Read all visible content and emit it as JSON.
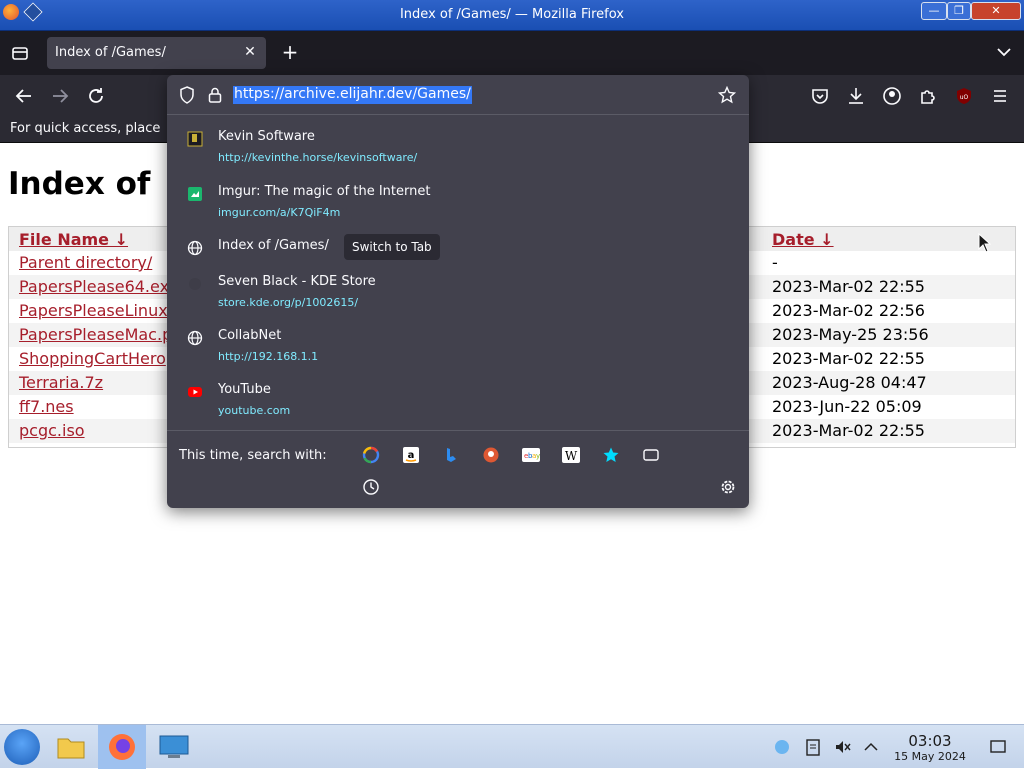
{
  "window": {
    "title": "Index of /Games/ — Mozilla Firefox"
  },
  "tab": {
    "title": "Index of /Games/"
  },
  "bookmark_bar": {
    "text": "For quick access, place"
  },
  "urlbar": {
    "url": "https://archive.elijahr.dev/Games/"
  },
  "page": {
    "heading": "Index of ",
    "columns": {
      "name": "File Name  ↓",
      "date": "Date  ↓"
    },
    "rows": [
      {
        "name": "Parent directory/",
        "date": "-"
      },
      {
        "name": "PapersPlease64.ex",
        "date": "2023-Mar-02 22:55"
      },
      {
        "name": "PapersPleaseLinux",
        "date": "2023-Mar-02 22:56"
      },
      {
        "name": "PapersPleaseMac.p",
        "date": "2023-May-25 23:56"
      },
      {
        "name": "ShoppingCartHero",
        "date": "2023-Mar-02 22:55"
      },
      {
        "name": "Terraria.7z",
        "date": "2023-Aug-28 04:47"
      },
      {
        "name": "ff7.nes",
        "date": "2023-Jun-22 05:09"
      },
      {
        "name": "pcgc.iso",
        "date": "2023-Mar-02 22:55"
      }
    ]
  },
  "suggestions": [
    {
      "title": "Kevin Software",
      "url": "http://kevinthe.horse/kevinsoftware/",
      "icon": "site-icon"
    },
    {
      "title": "Imgur: The magic of the Internet",
      "url": "imgur.com/a/K7QiF4m",
      "icon": "imgur-icon"
    },
    {
      "title": "Index of /Games/",
      "url": "",
      "icon": "globe-icon"
    },
    {
      "title": "Seven Black - KDE Store",
      "url": "store.kde.org/p/1002615/",
      "icon": "kde-icon"
    },
    {
      "title": "CollabNet",
      "url": "http://192.168.1.1",
      "icon": "globe-icon"
    },
    {
      "title": "YouTube",
      "url": "youtube.com",
      "icon": "youtube-icon"
    }
  ],
  "switch_to_tab": "Switch to Tab",
  "one_off": {
    "label": "This time, search with:"
  },
  "taskbar": {
    "time": "03:03",
    "date": "15 May 2024"
  }
}
